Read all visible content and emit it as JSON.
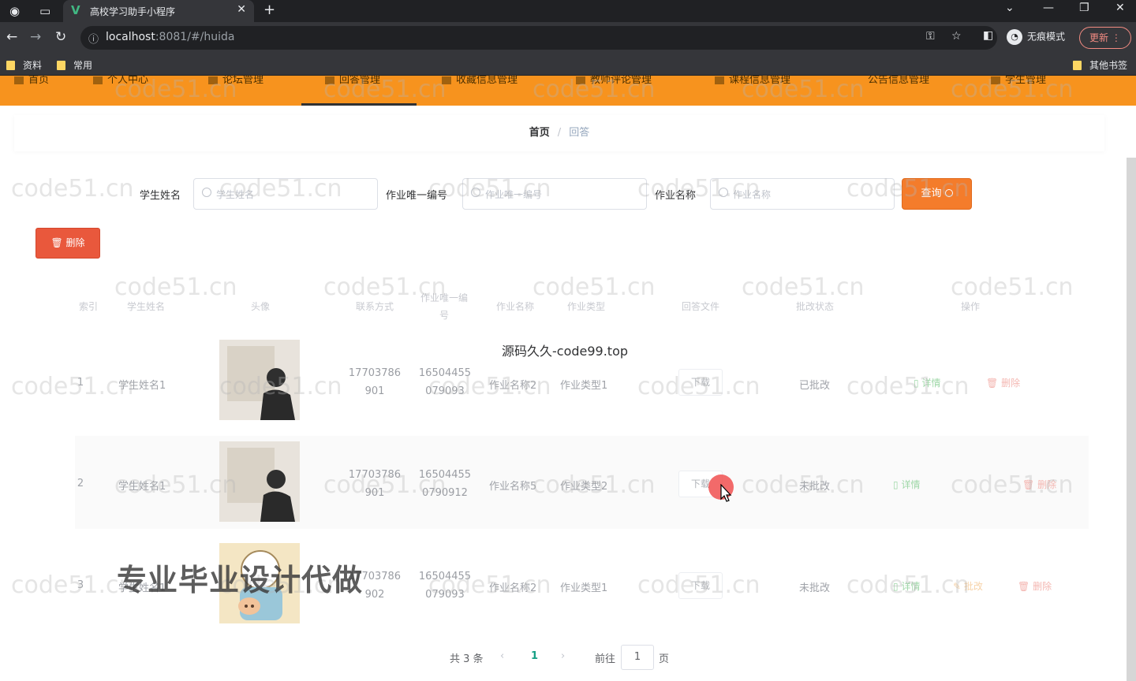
{
  "browser": {
    "tab_title": "高校学习助手小程序",
    "url_host": "localhost",
    "url_rest": ":8081/#/huida",
    "incognito_label": "无痕模式",
    "update_label": "更新",
    "bookmarks": [
      "资料",
      "常用"
    ],
    "bookmarks_right": "其他书签"
  },
  "topnav": {
    "items": [
      "首页",
      "个人中心",
      "论坛管理",
      "回答管理",
      "收藏信息管理",
      "教师评论管理",
      "课程信息管理",
      "公告信息管理",
      "学生管理"
    ],
    "active_index": 3,
    "bg_color": "#f7931e"
  },
  "breadcrumb": {
    "home": "首页",
    "sep": "/",
    "current": "回答"
  },
  "search": {
    "student_name_label": "学生姓名",
    "student_name_placeholder": "学生姓名",
    "homework_id_label": "作业唯一编号",
    "homework_id_placeholder": "作业唯一编号",
    "homework_name_label": "作业名称",
    "homework_name_placeholder": "作业名称",
    "query_label": "查询"
  },
  "toolbar": {
    "delete_label": "删除"
  },
  "table": {
    "headers": [
      "索引",
      "学生姓名",
      "头像",
      "联系方式",
      "作业唯一编号",
      "作业名称",
      "作业类型",
      "回答文件",
      "批改状态",
      "操作"
    ],
    "rows": [
      {
        "index": "1",
        "name": "学生姓名1",
        "phone_a": "17703786",
        "phone_b": "901",
        "hw_a": "16504455",
        "hw_b": "079093",
        "hw_name": "作业名称2",
        "hw_type": "作业类型1",
        "file": "下载",
        "status": "已批改",
        "actions": [
          "详情",
          "删除"
        ]
      },
      {
        "index": "2",
        "name": "学生姓名1",
        "phone_a": "17703786",
        "phone_b": "901",
        "hw_a": "16504455",
        "hw_b": "0790912",
        "hw_name": "作业名称5",
        "hw_type": "作业类型2",
        "file": "下载",
        "status": "未批改",
        "actions": [
          "详情",
          "删除"
        ]
      },
      {
        "index": "3",
        "name": "学生姓名1",
        "phone_a": "17703786",
        "phone_b": "902",
        "hw_a": "16504455",
        "hw_b": "079093",
        "hw_name": "作业名称2",
        "hw_type": "作业类型1",
        "file": "下载",
        "status": "未批改",
        "actions": [
          "详情",
          "批改",
          "删除"
        ]
      }
    ]
  },
  "pagination": {
    "total": "共 3 条",
    "prev": "‹",
    "current_page": "1",
    "next": "›",
    "goto_label": "前往",
    "goto_value": "1",
    "page_suffix": "页"
  },
  "overlays": {
    "watermark": "code51.cn",
    "center_text": "源码久久-code99.top",
    "ad_text": "专业毕业设计代做"
  }
}
